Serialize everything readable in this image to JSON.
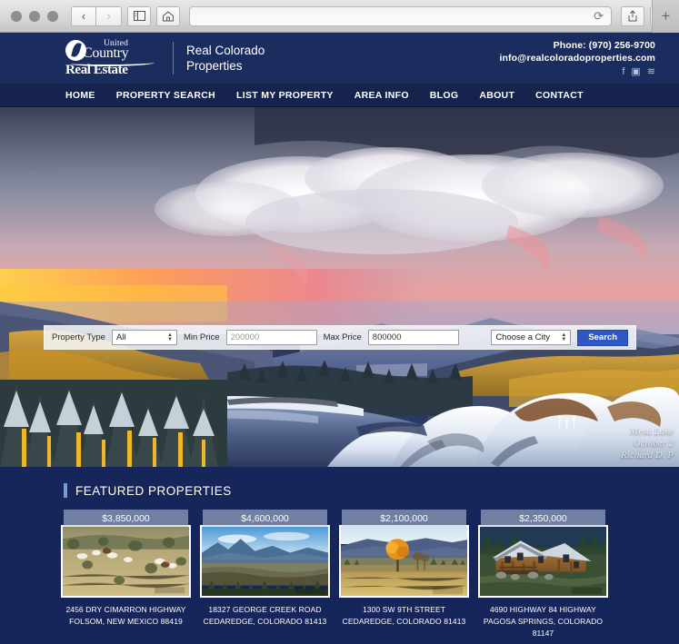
{
  "browser": {
    "back_icon": "‹",
    "forward_icon": "›",
    "sidebar_icon": "sidebar",
    "home_icon": "home",
    "url_value": "",
    "url_placeholder": "",
    "reload_icon": "⟳",
    "share_icon": "share",
    "tabs_icon": "tabs",
    "new_tab_label": "+"
  },
  "header": {
    "logo": {
      "united": "United",
      "country": "Country",
      "real_estate": "Real Estate"
    },
    "site_name_line1": "Real Colorado",
    "site_name_line2": "Properties",
    "phone": "Phone: (970) 256-9700",
    "email": "info@realcoloradoproperties.com",
    "socials": [
      {
        "name": "facebook-icon",
        "glyph": "f"
      },
      {
        "name": "youtube-icon",
        "glyph": "▣"
      },
      {
        "name": "rss-icon",
        "glyph": "≋"
      }
    ]
  },
  "nav": {
    "items": [
      {
        "label": "HOME"
      },
      {
        "label": "PROPERTY SEARCH"
      },
      {
        "label": "LIST MY PROPERTY"
      },
      {
        "label": "AREA INFO"
      },
      {
        "label": "BLOG"
      },
      {
        "label": "ABOUT"
      },
      {
        "label": "CONTACT"
      }
    ]
  },
  "hero": {
    "watermark_line1": "Mesa Lake",
    "watermark_line2": "October 2",
    "watermark_line3": "Richard D. P"
  },
  "search": {
    "property_type_label": "Property Type",
    "property_type_value": "All",
    "min_price_label": "Min Price",
    "min_price_value": "200000",
    "max_price_label": "Max Price",
    "max_price_value": "800000",
    "city_value": "Choose a City",
    "search_button": "Search"
  },
  "featured": {
    "title": "FEATURED PROPERTIES",
    "properties": [
      {
        "price": "$3,850,000",
        "address_line1": "2456 DRY CIMARRON HIGHWAY",
        "address_line2": "FOLSOM, NEW MEXICO 88419"
      },
      {
        "price": "$4,600,000",
        "address_line1": "18327 GEORGE CREEK ROAD",
        "address_line2": "CEDAREDGE, COLORADO 81413"
      },
      {
        "price": "$2,100,000",
        "address_line1": "1300 SW 9TH STREET",
        "address_line2": "CEDAREDGE, COLORADO 81413"
      },
      {
        "price": "$2,350,000",
        "address_line1": "4690 HIGHWAY 84 HIGHWAY",
        "address_line2": "PAGOSA SPRINGS, COLORADO 81147"
      }
    ]
  },
  "colors": {
    "header_navy": "#1b2c5e",
    "nav_navy": "#15234d",
    "body_navy": "#16265a",
    "accent_blue": "#7d9ad4",
    "button_blue": "#2f58c4"
  }
}
